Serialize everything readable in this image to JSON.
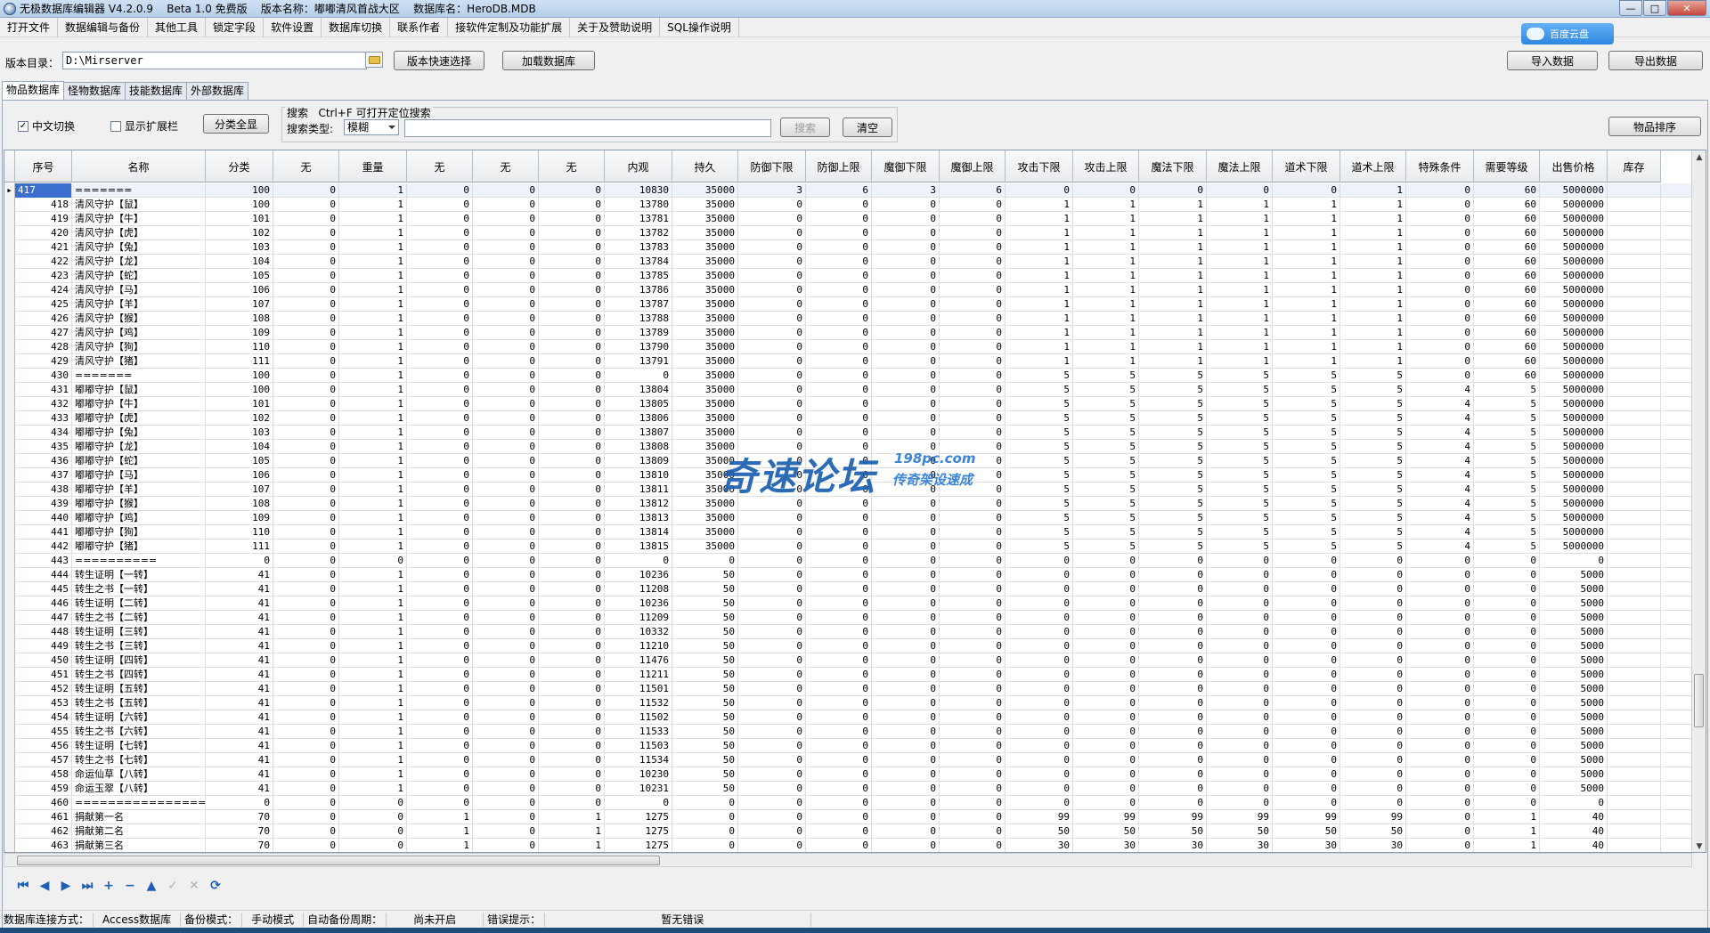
{
  "window": {
    "title": "无极数据库编辑器 V4.2.0.9    Beta 1.0 免费版    版本名称：嘟嘟清风首战大区    数据库名：HeroDB.MDB",
    "min": "—",
    "max": "□",
    "close": "✕"
  },
  "menu": [
    "打开文件",
    "数据编辑与备份",
    "其他工具",
    "锁定字段",
    "软件设置",
    "数据库切换",
    "联系作者",
    "接软件定制及功能扩展",
    "关于及赞助说明",
    "SQL操作说明"
  ],
  "baidu_badge": "百度云盘",
  "toolbar": {
    "dir_label": "版本目录：",
    "dir_value": "D:\\Mirserver",
    "quick_select": "版本快速选择",
    "load_db": "加载数据库",
    "import": "导入数据",
    "export": "导出数据"
  },
  "tabs": [
    "物品数据库",
    "怪物数据库",
    "技能数据库",
    "外部数据库"
  ],
  "filters": {
    "cn_switch": "中文切换",
    "cn_checked": true,
    "show_ext": "显示扩展栏",
    "show_ext_checked": false,
    "category_all": "分类全显",
    "search_title": "搜索   Ctrl+F 可打开定位搜索",
    "search_type_label": "搜索类型:",
    "search_type_value": "模糊",
    "search_placeholder": "",
    "search_btn": "搜索",
    "clear_btn": "清空",
    "sort_btn": "物品排序"
  },
  "grid": {
    "headers": [
      "序号",
      "名称",
      "分类",
      "无",
      "重量",
      "无",
      "无",
      "无",
      "内观",
      "持久",
      "防御下限",
      "防御上限",
      "魔御下限",
      "魔御上限",
      "攻击下限",
      "攻击上限",
      "魔法下限",
      "魔法上限",
      "道术下限",
      "道术上限",
      "特殊条件",
      "需要等级",
      "出售价格",
      "库存"
    ],
    "current_index": 0,
    "rows": [
      [
        "417",
        "=======",
        "100",
        "0",
        "1",
        "0",
        "0",
        "0",
        "10830",
        "35000",
        "3",
        "6",
        "3",
        "6",
        "0",
        "0",
        "0",
        "0",
        "0",
        "1",
        "0",
        "60",
        "5000000"
      ],
      [
        "418",
        "清风守护【鼠】",
        "100",
        "0",
        "1",
        "0",
        "0",
        "0",
        "13780",
        "35000",
        "0",
        "0",
        "0",
        "0",
        "1",
        "1",
        "1",
        "1",
        "1",
        "1",
        "0",
        "60",
        "5000000"
      ],
      [
        "419",
        "清风守护【牛】",
        "101",
        "0",
        "1",
        "0",
        "0",
        "0",
        "13781",
        "35000",
        "0",
        "0",
        "0",
        "0",
        "1",
        "1",
        "1",
        "1",
        "1",
        "1",
        "0",
        "60",
        "5000000"
      ],
      [
        "420",
        "清风守护【虎】",
        "102",
        "0",
        "1",
        "0",
        "0",
        "0",
        "13782",
        "35000",
        "0",
        "0",
        "0",
        "0",
        "1",
        "1",
        "1",
        "1",
        "1",
        "1",
        "0",
        "60",
        "5000000"
      ],
      [
        "421",
        "清风守护【兔】",
        "103",
        "0",
        "1",
        "0",
        "0",
        "0",
        "13783",
        "35000",
        "0",
        "0",
        "0",
        "0",
        "1",
        "1",
        "1",
        "1",
        "1",
        "1",
        "0",
        "60",
        "5000000"
      ],
      [
        "422",
        "清风守护【龙】",
        "104",
        "0",
        "1",
        "0",
        "0",
        "0",
        "13784",
        "35000",
        "0",
        "0",
        "0",
        "0",
        "1",
        "1",
        "1",
        "1",
        "1",
        "1",
        "0",
        "60",
        "5000000"
      ],
      [
        "423",
        "清风守护【蛇】",
        "105",
        "0",
        "1",
        "0",
        "0",
        "0",
        "13785",
        "35000",
        "0",
        "0",
        "0",
        "0",
        "1",
        "1",
        "1",
        "1",
        "1",
        "1",
        "0",
        "60",
        "5000000"
      ],
      [
        "424",
        "清风守护【马】",
        "106",
        "0",
        "1",
        "0",
        "0",
        "0",
        "13786",
        "35000",
        "0",
        "0",
        "0",
        "0",
        "1",
        "1",
        "1",
        "1",
        "1",
        "1",
        "0",
        "60",
        "5000000"
      ],
      [
        "425",
        "清风守护【羊】",
        "107",
        "0",
        "1",
        "0",
        "0",
        "0",
        "13787",
        "35000",
        "0",
        "0",
        "0",
        "0",
        "1",
        "1",
        "1",
        "1",
        "1",
        "1",
        "0",
        "60",
        "5000000"
      ],
      [
        "426",
        "清风守护【猴】",
        "108",
        "0",
        "1",
        "0",
        "0",
        "0",
        "13788",
        "35000",
        "0",
        "0",
        "0",
        "0",
        "1",
        "1",
        "1",
        "1",
        "1",
        "1",
        "0",
        "60",
        "5000000"
      ],
      [
        "427",
        "清风守护【鸡】",
        "109",
        "0",
        "1",
        "0",
        "0",
        "0",
        "13789",
        "35000",
        "0",
        "0",
        "0",
        "0",
        "1",
        "1",
        "1",
        "1",
        "1",
        "1",
        "0",
        "60",
        "5000000"
      ],
      [
        "428",
        "清风守护【狗】",
        "110",
        "0",
        "1",
        "0",
        "0",
        "0",
        "13790",
        "35000",
        "0",
        "0",
        "0",
        "0",
        "1",
        "1",
        "1",
        "1",
        "1",
        "1",
        "0",
        "60",
        "5000000"
      ],
      [
        "429",
        "清风守护【猪】",
        "111",
        "0",
        "1",
        "0",
        "0",
        "0",
        "13791",
        "35000",
        "0",
        "0",
        "0",
        "0",
        "1",
        "1",
        "1",
        "1",
        "1",
        "1",
        "0",
        "60",
        "5000000"
      ],
      [
        "430",
        "=======",
        "100",
        "0",
        "1",
        "0",
        "0",
        "0",
        "0",
        "35000",
        "0",
        "0",
        "0",
        "0",
        "5",
        "5",
        "5",
        "5",
        "5",
        "5",
        "0",
        "60",
        "5000000"
      ],
      [
        "431",
        "嘟嘟守护【鼠】",
        "100",
        "0",
        "1",
        "0",
        "0",
        "0",
        "13804",
        "35000",
        "0",
        "0",
        "0",
        "0",
        "5",
        "5",
        "5",
        "5",
        "5",
        "5",
        "4",
        "5",
        "5000000"
      ],
      [
        "432",
        "嘟嘟守护【牛】",
        "101",
        "0",
        "1",
        "0",
        "0",
        "0",
        "13805",
        "35000",
        "0",
        "0",
        "0",
        "0",
        "5",
        "5",
        "5",
        "5",
        "5",
        "5",
        "4",
        "5",
        "5000000"
      ],
      [
        "433",
        "嘟嘟守护【虎】",
        "102",
        "0",
        "1",
        "0",
        "0",
        "0",
        "13806",
        "35000",
        "0",
        "0",
        "0",
        "0",
        "5",
        "5",
        "5",
        "5",
        "5",
        "5",
        "4",
        "5",
        "5000000"
      ],
      [
        "434",
        "嘟嘟守护【兔】",
        "103",
        "0",
        "1",
        "0",
        "0",
        "0",
        "13807",
        "35000",
        "0",
        "0",
        "0",
        "0",
        "5",
        "5",
        "5",
        "5",
        "5",
        "5",
        "4",
        "5",
        "5000000"
      ],
      [
        "435",
        "嘟嘟守护【龙】",
        "104",
        "0",
        "1",
        "0",
        "0",
        "0",
        "13808",
        "35000",
        "0",
        "0",
        "0",
        "0",
        "5",
        "5",
        "5",
        "5",
        "5",
        "5",
        "4",
        "5",
        "5000000"
      ],
      [
        "436",
        "嘟嘟守护【蛇】",
        "105",
        "0",
        "1",
        "0",
        "0",
        "0",
        "13809",
        "35000",
        "0",
        "0",
        "0",
        "0",
        "5",
        "5",
        "5",
        "5",
        "5",
        "5",
        "4",
        "5",
        "5000000"
      ],
      [
        "437",
        "嘟嘟守护【马】",
        "106",
        "0",
        "1",
        "0",
        "0",
        "0",
        "13810",
        "35000",
        "0",
        "0",
        "0",
        "0",
        "5",
        "5",
        "5",
        "5",
        "5",
        "5",
        "4",
        "5",
        "5000000"
      ],
      [
        "438",
        "嘟嘟守护【羊】",
        "107",
        "0",
        "1",
        "0",
        "0",
        "0",
        "13811",
        "35000",
        "0",
        "0",
        "0",
        "0",
        "5",
        "5",
        "5",
        "5",
        "5",
        "5",
        "4",
        "5",
        "5000000"
      ],
      [
        "439",
        "嘟嘟守护【猴】",
        "108",
        "0",
        "1",
        "0",
        "0",
        "0",
        "13812",
        "35000",
        "0",
        "0",
        "0",
        "0",
        "5",
        "5",
        "5",
        "5",
        "5",
        "5",
        "4",
        "5",
        "5000000"
      ],
      [
        "440",
        "嘟嘟守护【鸡】",
        "109",
        "0",
        "1",
        "0",
        "0",
        "0",
        "13813",
        "35000",
        "0",
        "0",
        "0",
        "0",
        "5",
        "5",
        "5",
        "5",
        "5",
        "5",
        "4",
        "5",
        "5000000"
      ],
      [
        "441",
        "嘟嘟守护【狗】",
        "110",
        "0",
        "1",
        "0",
        "0",
        "0",
        "13814",
        "35000",
        "0",
        "0",
        "0",
        "0",
        "5",
        "5",
        "5",
        "5",
        "5",
        "5",
        "4",
        "5",
        "5000000"
      ],
      [
        "442",
        "嘟嘟守护【猪】",
        "111",
        "0",
        "1",
        "0",
        "0",
        "0",
        "13815",
        "35000",
        "0",
        "0",
        "0",
        "0",
        "5",
        "5",
        "5",
        "5",
        "5",
        "5",
        "4",
        "5",
        "5000000"
      ],
      [
        "443",
        "==========",
        "0",
        "0",
        "0",
        "0",
        "0",
        "0",
        "0",
        "0",
        "0",
        "0",
        "0",
        "0",
        "0",
        "0",
        "0",
        "0",
        "0",
        "0",
        "0",
        "0",
        "0"
      ],
      [
        "444",
        "转生证明【一转】",
        "41",
        "0",
        "1",
        "0",
        "0",
        "0",
        "10236",
        "50",
        "0",
        "0",
        "0",
        "0",
        "0",
        "0",
        "0",
        "0",
        "0",
        "0",
        "0",
        "0",
        "5000"
      ],
      [
        "445",
        "转生之书【一转】",
        "41",
        "0",
        "1",
        "0",
        "0",
        "0",
        "11208",
        "50",
        "0",
        "0",
        "0",
        "0",
        "0",
        "0",
        "0",
        "0",
        "0",
        "0",
        "0",
        "0",
        "5000"
      ],
      [
        "446",
        "转生证明【二转】",
        "41",
        "0",
        "1",
        "0",
        "0",
        "0",
        "10236",
        "50",
        "0",
        "0",
        "0",
        "0",
        "0",
        "0",
        "0",
        "0",
        "0",
        "0",
        "0",
        "0",
        "5000"
      ],
      [
        "447",
        "转生之书【二转】",
        "41",
        "0",
        "1",
        "0",
        "0",
        "0",
        "11209",
        "50",
        "0",
        "0",
        "0",
        "0",
        "0",
        "0",
        "0",
        "0",
        "0",
        "0",
        "0",
        "0",
        "5000"
      ],
      [
        "448",
        "转生证明【三转】",
        "41",
        "0",
        "1",
        "0",
        "0",
        "0",
        "10332",
        "50",
        "0",
        "0",
        "0",
        "0",
        "0",
        "0",
        "0",
        "0",
        "0",
        "0",
        "0",
        "0",
        "5000"
      ],
      [
        "449",
        "转生之书【三转】",
        "41",
        "0",
        "1",
        "0",
        "0",
        "0",
        "11210",
        "50",
        "0",
        "0",
        "0",
        "0",
        "0",
        "0",
        "0",
        "0",
        "0",
        "0",
        "0",
        "0",
        "5000"
      ],
      [
        "450",
        "转生证明【四转】",
        "41",
        "0",
        "1",
        "0",
        "0",
        "0",
        "11476",
        "50",
        "0",
        "0",
        "0",
        "0",
        "0",
        "0",
        "0",
        "0",
        "0",
        "0",
        "0",
        "0",
        "5000"
      ],
      [
        "451",
        "转生之书【四转】",
        "41",
        "0",
        "1",
        "0",
        "0",
        "0",
        "11211",
        "50",
        "0",
        "0",
        "0",
        "0",
        "0",
        "0",
        "0",
        "0",
        "0",
        "0",
        "0",
        "0",
        "5000"
      ],
      [
        "452",
        "转生证明【五转】",
        "41",
        "0",
        "1",
        "0",
        "0",
        "0",
        "11501",
        "50",
        "0",
        "0",
        "0",
        "0",
        "0",
        "0",
        "0",
        "0",
        "0",
        "0",
        "0",
        "0",
        "5000"
      ],
      [
        "453",
        "转生之书【五转】",
        "41",
        "0",
        "1",
        "0",
        "0",
        "0",
        "11532",
        "50",
        "0",
        "0",
        "0",
        "0",
        "0",
        "0",
        "0",
        "0",
        "0",
        "0",
        "0",
        "0",
        "5000"
      ],
      [
        "454",
        "转生证明【六转】",
        "41",
        "0",
        "1",
        "0",
        "0",
        "0",
        "11502",
        "50",
        "0",
        "0",
        "0",
        "0",
        "0",
        "0",
        "0",
        "0",
        "0",
        "0",
        "0",
        "0",
        "5000"
      ],
      [
        "455",
        "转生之书【六转】",
        "41",
        "0",
        "1",
        "0",
        "0",
        "0",
        "11533",
        "50",
        "0",
        "0",
        "0",
        "0",
        "0",
        "0",
        "0",
        "0",
        "0",
        "0",
        "0",
        "0",
        "5000"
      ],
      [
        "456",
        "转生证明【七转】",
        "41",
        "0",
        "1",
        "0",
        "0",
        "0",
        "11503",
        "50",
        "0",
        "0",
        "0",
        "0",
        "0",
        "0",
        "0",
        "0",
        "0",
        "0",
        "0",
        "0",
        "5000"
      ],
      [
        "457",
        "转生之书【七转】",
        "41",
        "0",
        "1",
        "0",
        "0",
        "0",
        "11534",
        "50",
        "0",
        "0",
        "0",
        "0",
        "0",
        "0",
        "0",
        "0",
        "0",
        "0",
        "0",
        "0",
        "5000"
      ],
      [
        "458",
        "命运仙草【八转】",
        "41",
        "0",
        "1",
        "0",
        "0",
        "0",
        "10230",
        "50",
        "0",
        "0",
        "0",
        "0",
        "0",
        "0",
        "0",
        "0",
        "0",
        "0",
        "0",
        "0",
        "5000"
      ],
      [
        "459",
        "命运玉翠【八转】",
        "41",
        "0",
        "1",
        "0",
        "0",
        "0",
        "10231",
        "50",
        "0",
        "0",
        "0",
        "0",
        "0",
        "0",
        "0",
        "0",
        "0",
        "0",
        "0",
        "0",
        "5000"
      ],
      [
        "460",
        "====================",
        "0",
        "0",
        "0",
        "0",
        "0",
        "0",
        "0",
        "0",
        "0",
        "0",
        "0",
        "0",
        "0",
        "0",
        "0",
        "0",
        "0",
        "0",
        "0",
        "0",
        "0"
      ],
      [
        "461",
        "捐献第一名",
        "70",
        "0",
        "0",
        "1",
        "0",
        "1",
        "1275",
        "0",
        "0",
        "0",
        "0",
        "0",
        "99",
        "99",
        "99",
        "99",
        "99",
        "99",
        "0",
        "1",
        "40"
      ],
      [
        "462",
        "捐献第二名",
        "70",
        "0",
        "0",
        "1",
        "0",
        "1",
        "1275",
        "0",
        "0",
        "0",
        "0",
        "0",
        "50",
        "50",
        "50",
        "50",
        "50",
        "50",
        "0",
        "1",
        "40"
      ],
      [
        "463",
        "捐献第三名",
        "70",
        "0",
        "0",
        "1",
        "0",
        "1",
        "1275",
        "0",
        "0",
        "0",
        "0",
        "0",
        "30",
        "30",
        "30",
        "30",
        "30",
        "30",
        "0",
        "1",
        "40"
      ]
    ]
  },
  "watermark": {
    "main": "奇速论坛",
    "url": "198pc.com",
    "sub": "传奇架设速成"
  },
  "nav_buttons": [
    {
      "icon": "first-record-icon",
      "glyph": "⏮",
      "enabled": true
    },
    {
      "icon": "prev-record-icon",
      "glyph": "◀",
      "enabled": true
    },
    {
      "icon": "next-record-icon",
      "glyph": "▶",
      "enabled": true
    },
    {
      "icon": "last-record-icon",
      "glyph": "⏭",
      "enabled": true
    },
    {
      "icon": "add-record-icon",
      "glyph": "+",
      "enabled": true
    },
    {
      "icon": "delete-record-icon",
      "glyph": "−",
      "enabled": true
    },
    {
      "icon": "edit-record-icon",
      "glyph": "▲",
      "enabled": true
    },
    {
      "icon": "post-record-icon",
      "glyph": "✓",
      "enabled": false
    },
    {
      "icon": "cancel-record-icon",
      "glyph": "✕",
      "enabled": false
    },
    {
      "icon": "refresh-icon",
      "glyph": "⟳",
      "enabled": true
    }
  ],
  "status": {
    "conn_label": "数据库连接方式：",
    "conn_value": "Access数据库",
    "backup_label": "备份模式：",
    "backup_value": "手动模式",
    "auto_label": "自动备份周期：",
    "auto_value": "尚未开启",
    "error_label": "错误提示：",
    "error_value": "暂无错误"
  }
}
